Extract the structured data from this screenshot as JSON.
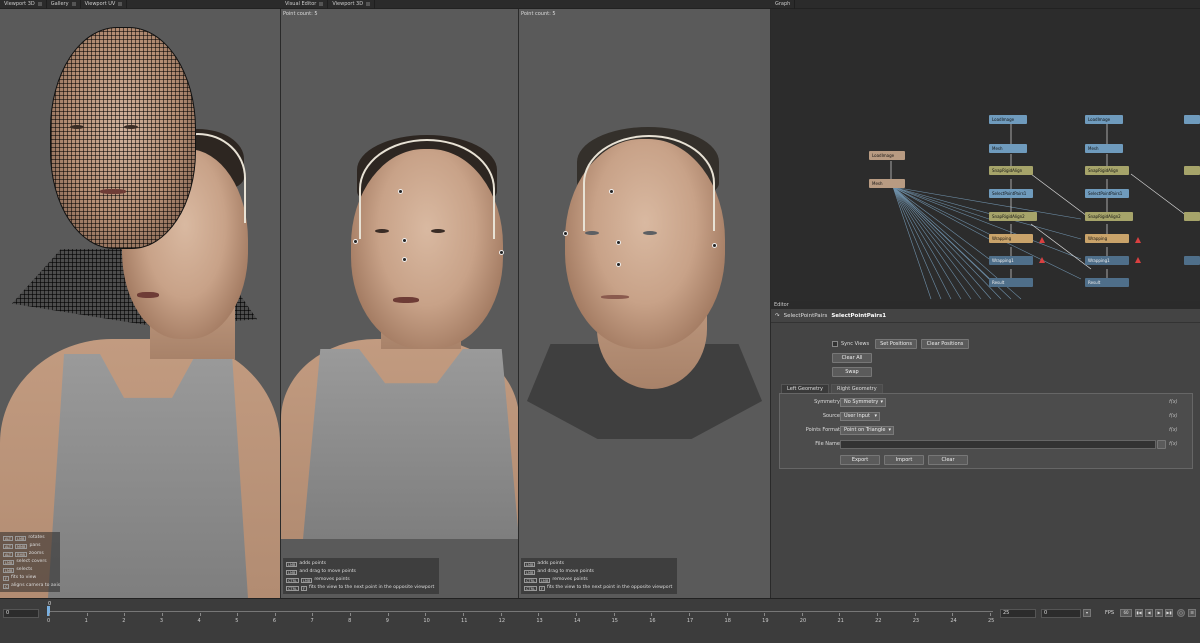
{
  "panes": {
    "left_tabs": [
      "Viewport 3D",
      "Gallery",
      "Viewport UV"
    ],
    "visual_editor_tabs": [
      "Visual Editor",
      "Viewport 3D"
    ],
    "graph_tab": "Graph",
    "editor_tab": "Editor"
  },
  "viewports": {
    "middle_point_count": "Point count: 5",
    "right_point_count": "Point count: 5",
    "left_help": [
      {
        "keys": [
          "ALT",
          "LMB"
        ],
        "text": "rotates"
      },
      {
        "keys": [
          "ALT",
          "MMB"
        ],
        "text": "pans"
      },
      {
        "keys": [
          "ALT",
          "RMB"
        ],
        "text": "zooms"
      },
      {
        "keys": [
          "LMB"
        ],
        "text": "select covers"
      },
      {
        "keys": [
          "LMB"
        ],
        "text": "selects"
      },
      {
        "keys": [
          "F"
        ],
        "text": "fits to view"
      },
      {
        "keys": [
          "C"
        ],
        "text": "aligns camera to axis"
      }
    ],
    "mid_help": [
      {
        "keys": [
          "LMB"
        ],
        "text": "adds points"
      },
      {
        "keys": [
          "LMB"
        ],
        "text": "and drag to move points"
      },
      {
        "keys": [
          "CTRL",
          "LMB"
        ],
        "text": "removes points"
      },
      {
        "keys": [
          "CTRL",
          "F"
        ],
        "text": "fits the view to the next point in the opposite viewport"
      }
    ],
    "right_help": [
      {
        "keys": [
          "LMB"
        ],
        "text": "adds points"
      },
      {
        "keys": [
          "LMB"
        ],
        "text": "and drag to move points"
      },
      {
        "keys": [
          "CTRL",
          "LMB"
        ],
        "text": "removes points"
      },
      {
        "keys": [
          "CTRL",
          "F"
        ],
        "text": "fits the view to the next point in the opposite viewport"
      }
    ]
  },
  "graph": {
    "nodes_col1": [
      "LoadImage",
      "Mesh"
    ],
    "nodes_col2": [
      "LoadImage",
      "Mesh",
      "SnapRigidAlign",
      "SelectPointPairs1",
      "SnapRigidAlign2",
      "Wrapping",
      "Wrapping1",
      "Result"
    ],
    "nodes_col3": [
      "LoadImage",
      "Mesh",
      "SnapRigidAlign",
      "SelectPointPairs1",
      "SnapRigidAlign2",
      "Wrapping",
      "Wrapping1",
      "Result"
    ]
  },
  "editor": {
    "node_type": "SelectPointPairs",
    "node_name": "SelectPointPairs1",
    "sync_views": "Sync Views",
    "set_positions": "Set Positions",
    "clear_positions": "Clear Positions",
    "clear_all": "Clear All",
    "swap": "Swap",
    "tab_left": "Left Geometry",
    "tab_right": "Right Geometry",
    "symmetry_label": "Symmetry",
    "symmetry_value": "No Symmetry",
    "source_label": "Source",
    "source_value": "User Input",
    "points_format_label": "Points Format",
    "points_format_value": "Point on Triangle",
    "file_name_label": "File Name",
    "export": "Export",
    "import": "Import",
    "clear": "Clear",
    "fx": "f(x)"
  },
  "timeline": {
    "start": "0",
    "current": "0",
    "end": "25",
    "frame": "0",
    "fps_label": "FPS",
    "fps_value": "60",
    "ticks": [
      "0",
      "1",
      "2",
      "3",
      "4",
      "5",
      "6",
      "7",
      "8",
      "9",
      "10",
      "11",
      "12",
      "13",
      "14",
      "15",
      "16",
      "17",
      "18",
      "19",
      "20",
      "21",
      "22",
      "23",
      "24",
      "25"
    ]
  }
}
